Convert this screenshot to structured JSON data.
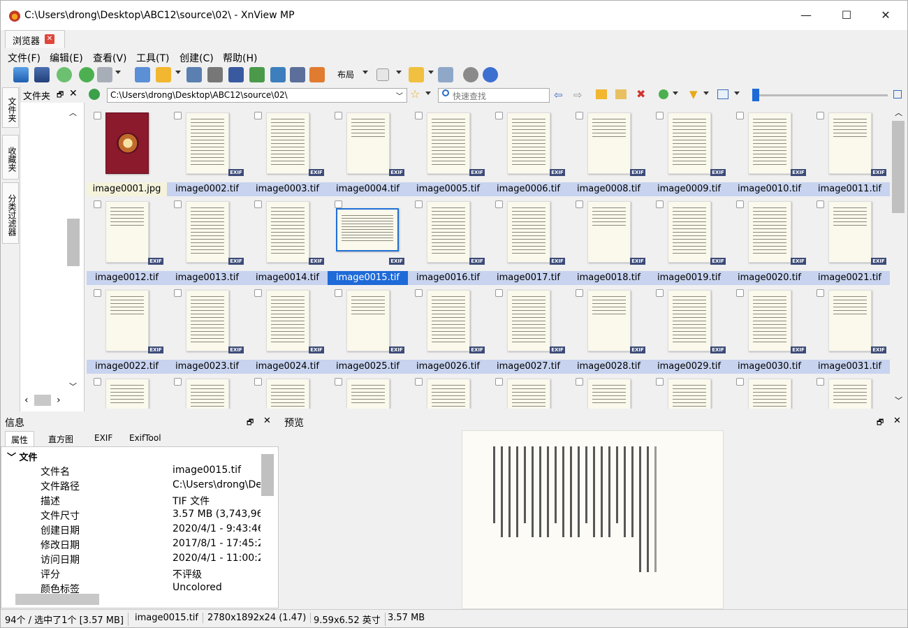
{
  "window": {
    "title": "C:\\Users\\drong\\Desktop\\ABC12\\source\\02\\ - XnView MP",
    "btn_minimize": "—",
    "btn_maximize": "☐",
    "btn_close": "✕"
  },
  "doc_tab": {
    "label": "浏览器"
  },
  "menu": [
    "文件(F)",
    "编辑(E)",
    "查看(V)",
    "工具(T)",
    "创建(C)",
    "帮助(H)"
  ],
  "toolbar": {
    "layout_label": "布局"
  },
  "side_tabs": [
    "文件夹",
    "收藏夹",
    "分类过滤器"
  ],
  "folder_panel": {
    "title": "文件夹",
    "close": "✕"
  },
  "address": {
    "path": "C:\\Users\\drong\\Desktop\\ABC12\\source\\02\\",
    "search_placeholder": "快速查找"
  },
  "thumbnails": {
    "row1": [
      "image0001.jpg",
      "image0002.tif",
      "image0003.tif",
      "image0004.tif",
      "image0005.tif",
      "image0006.tif",
      "image0008.tif",
      "image0009.tif",
      "image0010.tif",
      "image0011.tif"
    ],
    "row2": [
      "image0012.tif",
      "image0013.tif",
      "image0014.tif",
      "image0015.tif",
      "image0016.tif",
      "image0017.tif",
      "image0018.tif",
      "image0019.tif",
      "image0020.tif",
      "image0021.tif"
    ],
    "row3": [
      "image0022.tif",
      "image0023.tif",
      "image0024.tif",
      "image0025.tif",
      "image0026.tif",
      "image0027.tif",
      "image0028.tif",
      "image0029.tif",
      "image0030.tif",
      "image0031.tif"
    ],
    "exif_badge": "EXIF",
    "selected": "image0015.tif"
  },
  "info_panel": {
    "title": "信息",
    "tabs": [
      "属性",
      "直方图",
      "EXIF",
      "ExifTool"
    ],
    "section": "文件",
    "props": [
      {
        "key": "文件名",
        "value": "image0015.tif"
      },
      {
        "key": "文件路径",
        "value": "C:\\Users\\drong\\De"
      },
      {
        "key": "描述",
        "value": "TIF 文件"
      },
      {
        "key": "文件尺寸",
        "value": "3.57 MB (3,743,96"
      },
      {
        "key": "创建日期",
        "value": "2020/4/1 - 9:43:46"
      },
      {
        "key": "修改日期",
        "value": "2017/8/1 - 17:45:2"
      },
      {
        "key": "访问日期",
        "value": "2020/4/1 - 11:00:2"
      },
      {
        "key": "评分",
        "value": "不评级"
      },
      {
        "key": "颜色标签",
        "value": "Uncolored"
      }
    ]
  },
  "preview_panel": {
    "title": "预览"
  },
  "statusbar": {
    "count": "94个 / 选中了1个 [3.57 MB]",
    "filename": "image0015.tif",
    "dimensions": "2780x1892x24 (1.47)",
    "print_size": "9.59x6.52 英寸",
    "filesize": "3.57 MB"
  },
  "colors": {
    "selection": "#1e6ad8",
    "name_bg": "#c7d3ef",
    "accent_red": "#e0463c"
  }
}
